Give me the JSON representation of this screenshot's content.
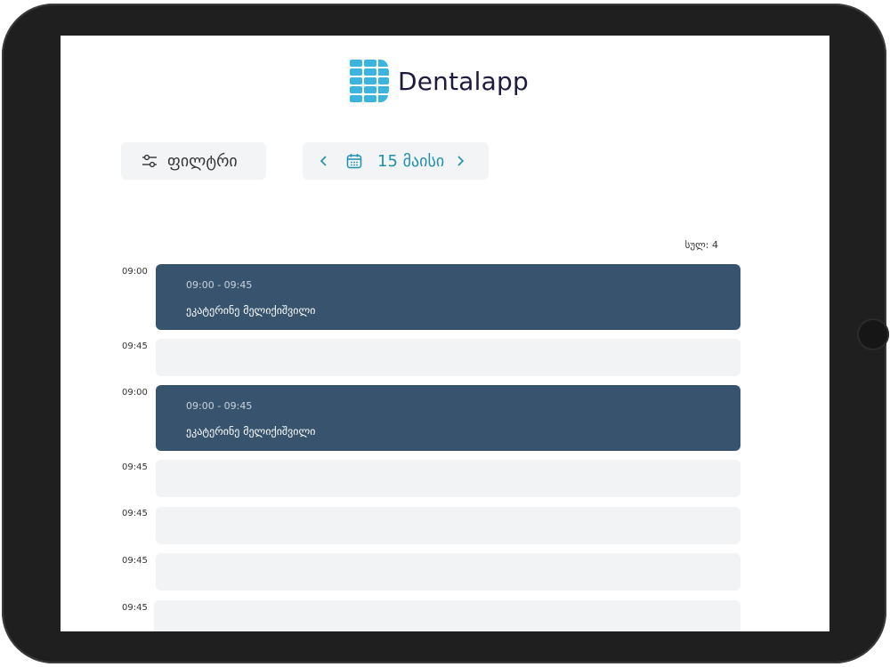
{
  "app": {
    "name": "Dentalapp"
  },
  "toolbar": {
    "filter_label": "ფილტრი",
    "date_label": "15 მაისი"
  },
  "schedule": {
    "total_label": "სულ: 4",
    "rows": [
      {
        "time": "09:00",
        "type": "booked",
        "range": "09:00 - 09:45",
        "patient": "ეკატერინე მელიქიშვილი"
      },
      {
        "time": "09:45",
        "type": "empty"
      },
      {
        "time": "09:00",
        "type": "booked",
        "range": "09:00 - 09:45",
        "patient": "ეკატერინე მელიქიშვილი"
      },
      {
        "time": "09:45",
        "type": "empty"
      },
      {
        "time": "09:45",
        "type": "empty"
      },
      {
        "time": "09:45",
        "type": "empty"
      },
      {
        "time": "09:45",
        "type": "empty"
      }
    ]
  },
  "colors": {
    "booked": "#37536e",
    "empty": "#f2f3f4",
    "accent": "#1f8fb0",
    "logo": "#3bb5e0"
  }
}
